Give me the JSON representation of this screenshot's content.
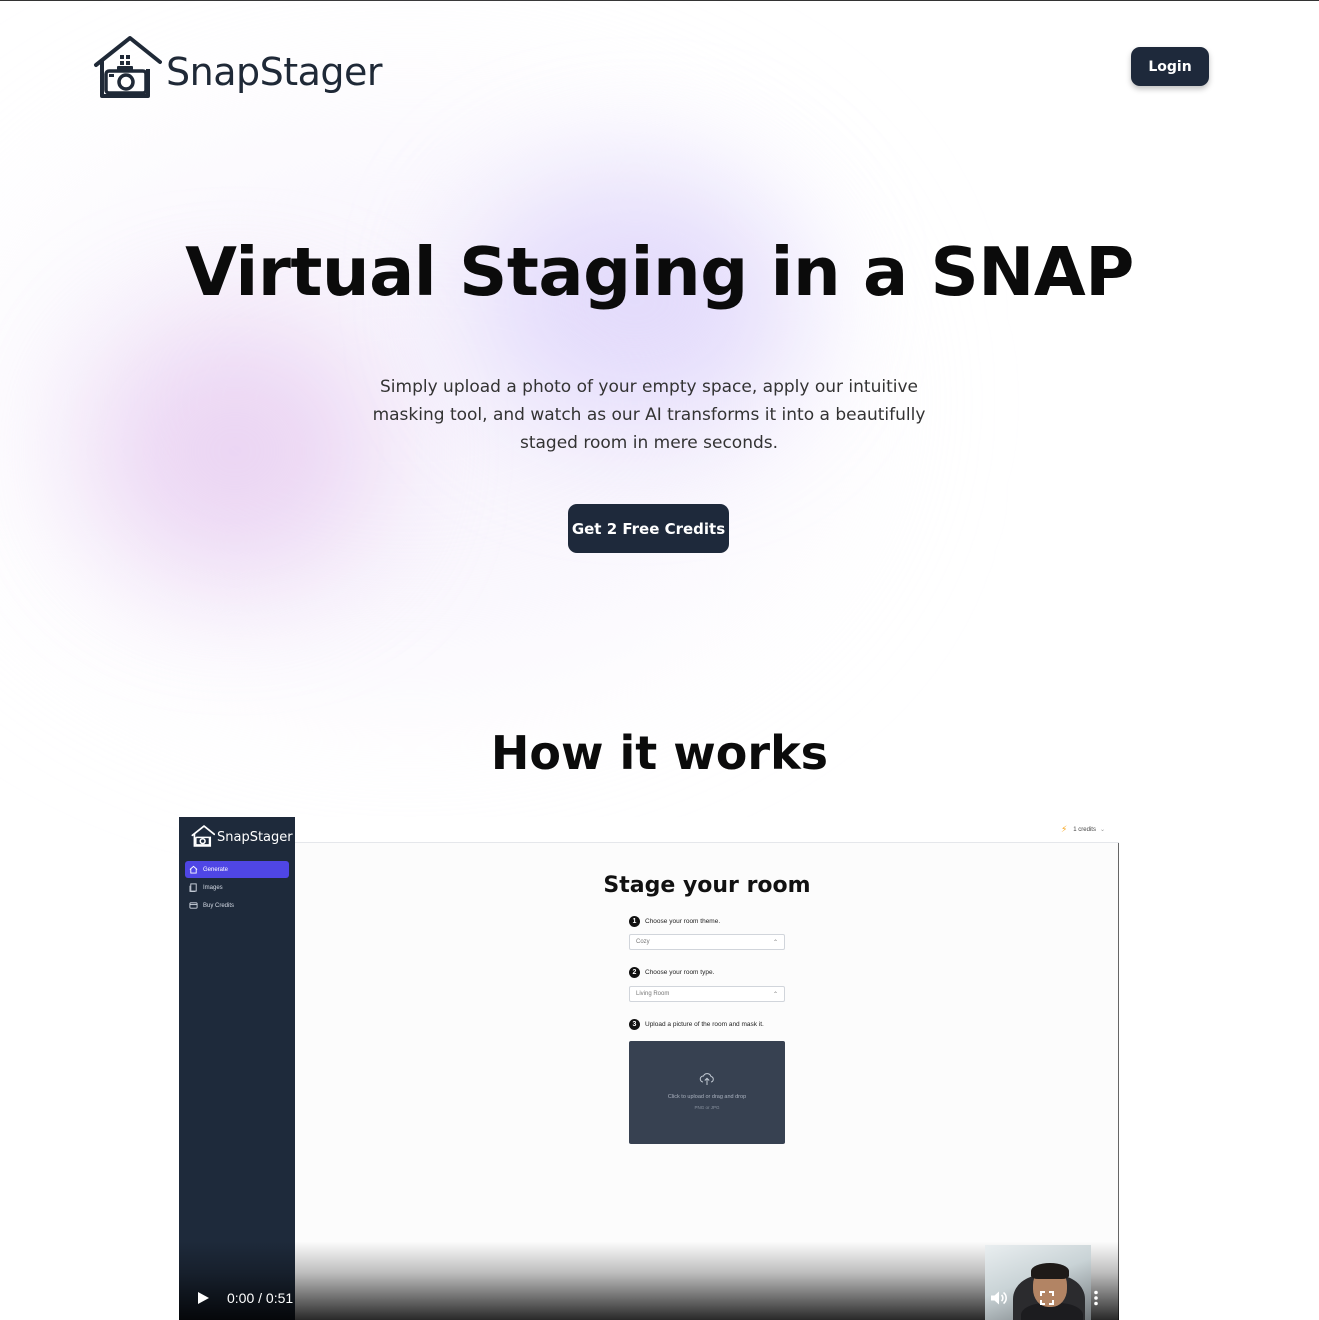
{
  "header": {
    "brand": "SnapStager",
    "login_label": "Login"
  },
  "hero": {
    "title": "Virtual Staging in a SNAP",
    "subtitle": "Simply upload a photo of your empty space, apply our intuitive masking tool, and watch as our AI transforms it into a beautifully staged room in mere seconds.",
    "cta_label": "Get 2 Free Credits"
  },
  "how": {
    "title": "How it works"
  },
  "video": {
    "app": {
      "brand": "SnapStager",
      "nav": [
        {
          "label": "Generate",
          "icon": "home-icon",
          "active": true
        },
        {
          "label": "Images",
          "icon": "images-icon",
          "active": false
        },
        {
          "label": "Buy Credits",
          "icon": "credits-icon",
          "active": false
        }
      ],
      "credits": "1 credits",
      "stage_title": "Stage your room",
      "steps": [
        {
          "num": "1",
          "label": "Choose your room theme.",
          "value": "Cozy"
        },
        {
          "num": "2",
          "label": "Choose your room type.",
          "value": "Living Room"
        },
        {
          "num": "3",
          "label": "Upload a picture of the room and mask it."
        }
      ],
      "upload": {
        "primary": "Click to upload or drag and drop",
        "secondary": "PNG or JPG"
      }
    },
    "player": {
      "time": "0:00 / 0:51"
    }
  },
  "colors": {
    "primary_button": "#1e293b",
    "sidebar": "#1e2a3b",
    "active_nav": "#4f46e5",
    "upload_box": "#374151"
  }
}
